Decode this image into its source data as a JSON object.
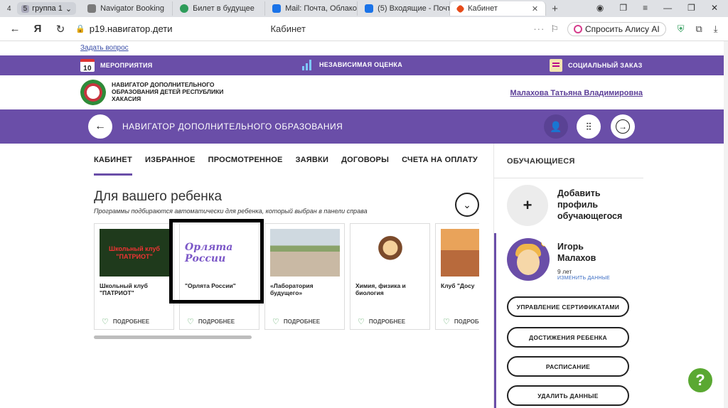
{
  "browser": {
    "tab_count": "4",
    "group_badge": "5",
    "group_label": "группа 1",
    "tabs": [
      {
        "label": "Navigator Booking",
        "color": "#7a7a7a"
      },
      {
        "label": "Билет в будущее",
        "color": "#2e9c5a"
      },
      {
        "label": "Mail: Почта, Облако, К",
        "color": "#1a73e8"
      },
      {
        "label": "(5) Входящие - Почта",
        "color": "#1a73e8"
      },
      {
        "label": "Кабинет",
        "color": "#e64a19"
      }
    ],
    "url": "p19.навигатор.дети",
    "page_title": "Кабинет",
    "alice_label": "Спросить Алису AI"
  },
  "site": {
    "ask_link": "Задать вопрос",
    "topnav": {
      "calendar_day": "10",
      "events": "МЕРОПРИЯТИЯ",
      "assessment": "НЕЗАВИСИМАЯ ОЦЕНКА",
      "social_order": "СОЦИАЛЬНЫЙ ЗАКАЗ"
    },
    "org_name": "НАВИГАТОР ДОПОЛНИТЕЛЬНОГО ОБРАЗОВАНИЯ ДЕТЕЙ РЕСПУБЛИКИ ХАКАСИЯ",
    "user_name": "Малахова Татьяна Владимировна",
    "nav_title": "НАВИГАТОР ДОПОЛНИТЕЛЬНОГО ОБРАЗОВАНИЯ"
  },
  "main": {
    "tabs": [
      "КАБИНЕТ",
      "ИЗБРАННОЕ",
      "ПРОСМОТРЕННОЕ",
      "ЗАЯВКИ",
      "ДОГОВОРЫ",
      "СЧЕТА НА ОПЛАТУ"
    ],
    "section_title": "Для вашего ребенка",
    "section_subtitle": "Программы подбираются автоматически для ребенка, который выбран в панели справа",
    "cards": [
      {
        "name": "Школьный клуб \"ПАТРИОТ\"",
        "img_text": "Школьный клуб \"ПАТРИОТ\""
      },
      {
        "name": "\"Орлята России\"",
        "img_text": "Орлята России"
      },
      {
        "name": "«Лаборатория будущего»",
        "img_text": ""
      },
      {
        "name": "Химия, физика и биология",
        "img_text": ""
      },
      {
        "name": "Клуб \"Досу",
        "img_text": ""
      }
    ],
    "card_more_label": "ПОДРОБНЕЕ"
  },
  "panel": {
    "title": "ОБУЧАЮЩИЕСЯ",
    "add_profile": "Добавить профиль обучающегося",
    "child": {
      "name": "Игорь Малахов",
      "age": "9 лет",
      "edit": "ИЗМЕНИТЬ ДАННЫЕ"
    },
    "buttons": [
      "УПРАВЛЕНИЕ СЕРТИФИКАТАМИ",
      "ДОСТИЖЕНИЯ РЕБЕНКА",
      "РАСПИСАНИЕ",
      "УДАЛИТЬ ДАННЫЕ"
    ]
  },
  "colors": {
    "brand_purple": "#6a4ea8",
    "help_green": "#5aa832"
  }
}
